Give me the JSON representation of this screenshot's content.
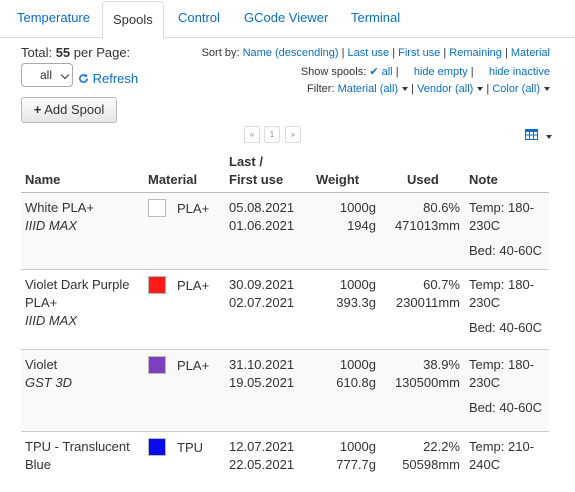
{
  "tabs": [
    "Temperature",
    "Spools",
    "Control",
    "GCode Viewer",
    "Terminal"
  ],
  "total": {
    "label": "Total:",
    "count": "55",
    "per_page": "per Page:"
  },
  "per_page_value": "all",
  "refresh_label": "Refresh",
  "add_spool_label": "Add Spool",
  "sort": {
    "label": "Sort by:",
    "options": [
      "Name (descending)",
      "Last use",
      "First use",
      "Remaining",
      "Material"
    ]
  },
  "show": {
    "label": "Show spools:",
    "all": "all",
    "hide_empty": "hide empty",
    "hide_inactive": "hide inactive"
  },
  "filter": {
    "label": "Filter:",
    "material": "Material (all)",
    "vendor": "Vendor (all)",
    "color": "Color (all)"
  },
  "pager": {
    "prev": "«",
    "page": "1",
    "next": "»"
  },
  "columns": {
    "name": "Name",
    "material": "Material",
    "use_1": "Last /",
    "use_2": "First use",
    "weight": "Weight",
    "used": "Used",
    "note": "Note"
  },
  "spools": [
    {
      "name_1": "White PLA+",
      "name_2": "",
      "vendor": "IIID MAX",
      "color": "#ffffff",
      "material": "PLA+",
      "last_use": "05.08.2021",
      "first_use": "01.06.2021",
      "weight": "1000g",
      "remaining": "194g",
      "used_pct": "80.6%",
      "used_len": "471013mm",
      "note_1": "Temp: 180-",
      "note_2": "230C",
      "note_3": "Bed: 40-60C"
    },
    {
      "name_1": "Violet Dark Purple",
      "name_2": "PLA+",
      "vendor": "IIID MAX",
      "color": "#ff1a1a",
      "material": "PLA+",
      "last_use": "30.09.2021",
      "first_use": "02.07.2021",
      "weight": "1000g",
      "remaining": "393.3g",
      "used_pct": "60.7%",
      "used_len": "230011mm",
      "note_1": "Temp: 180-",
      "note_2": "230C",
      "note_3": "Bed: 40-60C"
    },
    {
      "name_1": "Violet",
      "name_2": "",
      "vendor": "GST 3D",
      "color": "#7b3fbf",
      "material": "PLA+",
      "last_use": "31.10.2021",
      "first_use": "19.05.2021",
      "weight": "1000g",
      "remaining": "610.8g",
      "used_pct": "38.9%",
      "used_len": "130500mm",
      "note_1": "Temp: 180-",
      "note_2": "230C",
      "note_3": "Bed: 40-60C"
    },
    {
      "name_1": "TPU - Translucent",
      "name_2": "Blue",
      "vendor": "",
      "color": "#0a0aee",
      "material": "TPU",
      "last_use": "12.07.2021",
      "first_use": "22.05.2021",
      "weight": "1000g",
      "remaining": "777.7g",
      "used_pct": "22.2%",
      "used_len": "50598mm",
      "note_1": "Temp: 210-",
      "note_2": "240C",
      "note_3": ""
    }
  ]
}
